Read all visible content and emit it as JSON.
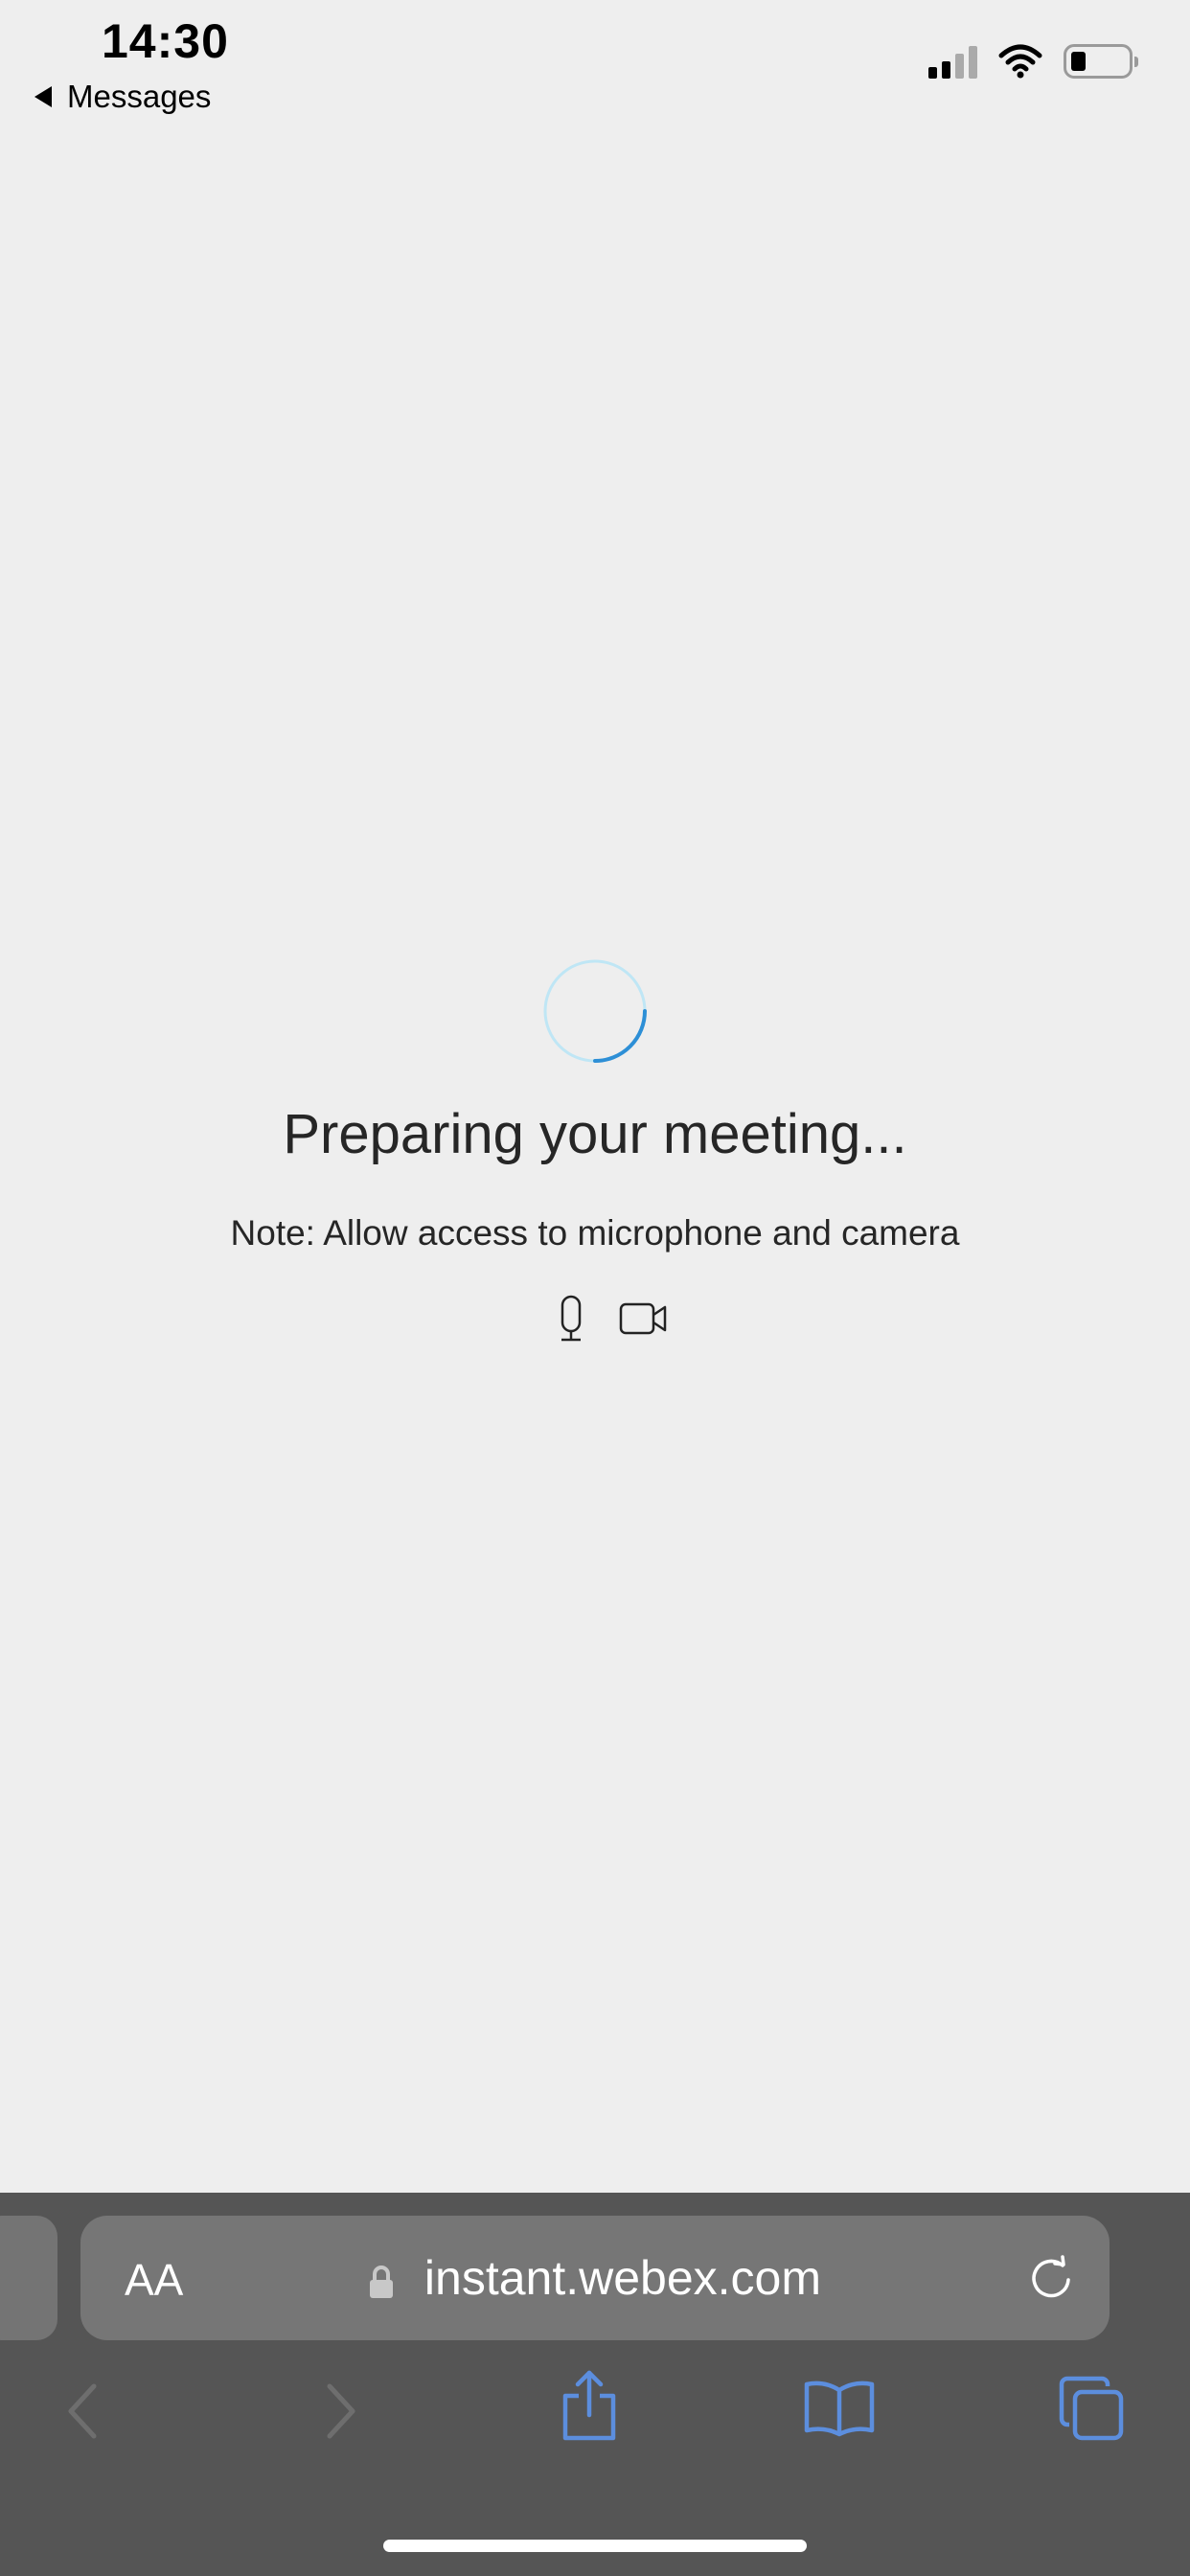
{
  "status_bar": {
    "time": "14:30",
    "back_label": "Messages",
    "icons": [
      "signal-icon",
      "wifi-icon",
      "battery-icon"
    ]
  },
  "main": {
    "loading_icon": "spinner-icon",
    "heading": "Preparing your meeting...",
    "note": "Note: Allow access to microphone and camera",
    "permission_icons": [
      "microphone-icon",
      "camera-icon"
    ]
  },
  "browser": {
    "text_size_label": "AA",
    "url": "instant.webex.com",
    "toolbar": [
      "back-icon",
      "forward-icon",
      "share-icon",
      "bookmarks-icon",
      "tabs-icon"
    ]
  },
  "colors": {
    "background": "#eeeeee",
    "spinner": "#2d8fd6",
    "toolbar_blue": "#5c8ede",
    "browser_bar": "#555555"
  }
}
